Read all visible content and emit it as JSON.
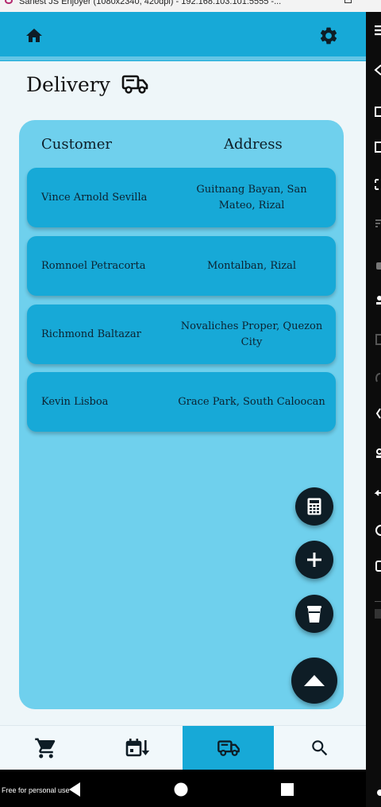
{
  "window": {
    "title": "Sanest JS Enjoyer (1080x2340, 420dpi) - 192.168.103.101:5555 -..."
  },
  "appbar": {
    "home_icon": "home-icon",
    "settings_icon": "gear-icon",
    "color": "#17a9d7"
  },
  "page": {
    "title": "Delivery",
    "title_icon": "truck-icon"
  },
  "table": {
    "headers": {
      "customer": "Customer",
      "address": "Address"
    },
    "rows": [
      {
        "customer": "Vince Arnold Sevilla",
        "address": "Guitnang Bayan, San Mateo, Rizal"
      },
      {
        "customer": "Romnoel Petracorta",
        "address": "Montalban, Rizal"
      },
      {
        "customer": "Richmond Baltazar",
        "address": "Novaliches Proper, Quezon City"
      },
      {
        "customer": "Kevin Lisboa",
        "address": "Grace Park, South Caloocan"
      }
    ]
  },
  "fabs": {
    "calculator_icon": "calculator-icon",
    "add_icon": "plus-icon",
    "trash_icon": "trash-icon",
    "scroll_top_icon": "arrow-up-icon"
  },
  "bottom_nav": {
    "items": [
      {
        "icon": "cart-icon",
        "active": false
      },
      {
        "icon": "calendar-sort-icon",
        "active": false
      },
      {
        "icon": "truck-icon",
        "active": true
      },
      {
        "icon": "search-icon",
        "active": false
      }
    ]
  },
  "system_nav": {
    "back_icon": "back-triangle-icon",
    "home_icon": "home-circle-icon",
    "recents_icon": "recents-square-icon"
  },
  "watermark": "Free for personal use"
}
